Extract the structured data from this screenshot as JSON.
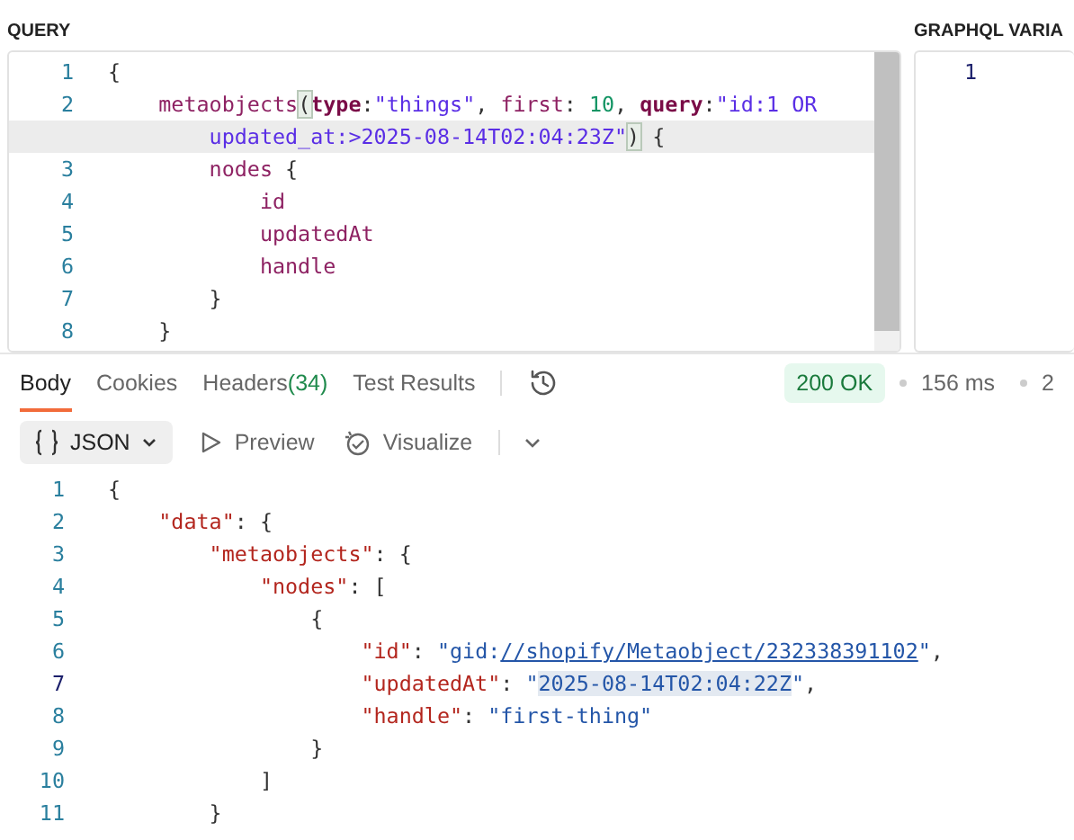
{
  "query_panel": {
    "label": "QUERY",
    "lines": [
      {
        "number": "1",
        "current": false,
        "tokens": [
          {
            "text": "{",
            "kind": "punct"
          }
        ]
      },
      {
        "number": "2",
        "current": false,
        "tokens": [
          {
            "text": "    metaobjects",
            "kind": "field"
          },
          {
            "text": "(",
            "kind": "match"
          },
          {
            "text": "type",
            "kind": "keyword"
          },
          {
            "text": ":",
            "kind": "punct"
          },
          {
            "text": "\"things\"",
            "kind": "string"
          },
          {
            "text": ", ",
            "kind": "punct"
          },
          {
            "text": "first",
            "kind": "field"
          },
          {
            "text": ": ",
            "kind": "punct"
          },
          {
            "text": "10",
            "kind": "number"
          },
          {
            "text": ", ",
            "kind": "punct"
          },
          {
            "text": "query",
            "kind": "keyword"
          },
          {
            "text": ":",
            "kind": "punct"
          },
          {
            "text": "\"id:1 OR",
            "kind": "string"
          }
        ]
      },
      {
        "current": true,
        "tokens": [
          {
            "text": "        updated_at:>2025-08-14T02:04:23Z\"",
            "kind": "string"
          },
          {
            "text": ")",
            "kind": "match"
          },
          {
            "text": " {",
            "kind": "punct"
          }
        ]
      },
      {
        "number": "3",
        "current": false,
        "tokens": [
          {
            "text": "        nodes",
            "kind": "field"
          },
          {
            "text": " {",
            "kind": "punct"
          }
        ]
      },
      {
        "number": "4",
        "current": false,
        "tokens": [
          {
            "text": "            id",
            "kind": "field"
          }
        ]
      },
      {
        "number": "5",
        "current": false,
        "tokens": [
          {
            "text": "            updatedAt",
            "kind": "field"
          }
        ]
      },
      {
        "number": "6",
        "current": false,
        "tokens": [
          {
            "text": "            handle",
            "kind": "field"
          }
        ]
      },
      {
        "number": "7",
        "current": false,
        "tokens": [
          {
            "text": "        }",
            "kind": "punct"
          }
        ]
      },
      {
        "number": "8",
        "current": false,
        "tokens": [
          {
            "text": "    }",
            "kind": "punct"
          }
        ]
      }
    ]
  },
  "variables_panel": {
    "label": "GRAPHQL VARIA",
    "lines": [
      {
        "number": "1"
      }
    ]
  },
  "response_tabs": [
    {
      "label": "Body",
      "selected": true
    },
    {
      "label": "Cookies",
      "selected": false
    },
    {
      "label": "Headers",
      "count": "(34)",
      "selected": false
    },
    {
      "label": "Test Results",
      "selected": false
    }
  ],
  "status": {
    "code": "200 OK",
    "time": "156 ms",
    "size": "2"
  },
  "view_bar": {
    "format": "JSON",
    "preview": "Preview",
    "visualize": "Visualize"
  },
  "response_lines": [
    {
      "number": "1",
      "active": false,
      "tokens": [
        {
          "text": "{",
          "kind": "punct"
        }
      ]
    },
    {
      "number": "2",
      "active": false,
      "tokens": [
        {
          "text": "    \"data\"",
          "kind": "key"
        },
        {
          "text": ": {",
          "kind": "punct"
        }
      ]
    },
    {
      "number": "3",
      "active": false,
      "tokens": [
        {
          "text": "        \"metaobjects\"",
          "kind": "key"
        },
        {
          "text": ": {",
          "kind": "punct"
        }
      ]
    },
    {
      "number": "4",
      "active": false,
      "tokens": [
        {
          "text": "            \"nodes\"",
          "kind": "key"
        },
        {
          "text": ": [",
          "kind": "punct"
        }
      ]
    },
    {
      "number": "5",
      "active": false,
      "tokens": [
        {
          "text": "                {",
          "kind": "punct"
        }
      ]
    },
    {
      "number": "6",
      "active": false,
      "tokens": [
        {
          "text": "                    \"id\"",
          "kind": "key"
        },
        {
          "text": ": ",
          "kind": "punct"
        },
        {
          "text": "\"gid:",
          "kind": "value"
        },
        {
          "text": "//shopify/Metaobject/232338391102",
          "kind": "link"
        },
        {
          "text": "\"",
          "kind": "value"
        },
        {
          "text": ",",
          "kind": "punct"
        }
      ]
    },
    {
      "number": "7",
      "active": true,
      "tokens": [
        {
          "text": "                    \"updatedAt\"",
          "kind": "key"
        },
        {
          "text": ": ",
          "kind": "punct"
        },
        {
          "text": "\"",
          "kind": "value"
        },
        {
          "text": "2025-08-14T02:04:22Z",
          "kind": "selection"
        },
        {
          "text": "\"",
          "kind": "value"
        },
        {
          "text": ",",
          "kind": "punct"
        }
      ]
    },
    {
      "number": "8",
      "active": false,
      "tokens": [
        {
          "text": "                    \"handle\"",
          "kind": "key"
        },
        {
          "text": ": ",
          "kind": "punct"
        },
        {
          "text": "\"first-thing\"",
          "kind": "value"
        }
      ]
    },
    {
      "number": "9",
      "active": false,
      "tokens": [
        {
          "text": "                }",
          "kind": "punct"
        }
      ]
    },
    {
      "number": "10",
      "active": false,
      "tokens": [
        {
          "text": "            ]",
          "kind": "punct"
        }
      ]
    },
    {
      "number": "11",
      "active": false,
      "tokens": [
        {
          "text": "        }",
          "kind": "punct"
        }
      ]
    }
  ]
}
